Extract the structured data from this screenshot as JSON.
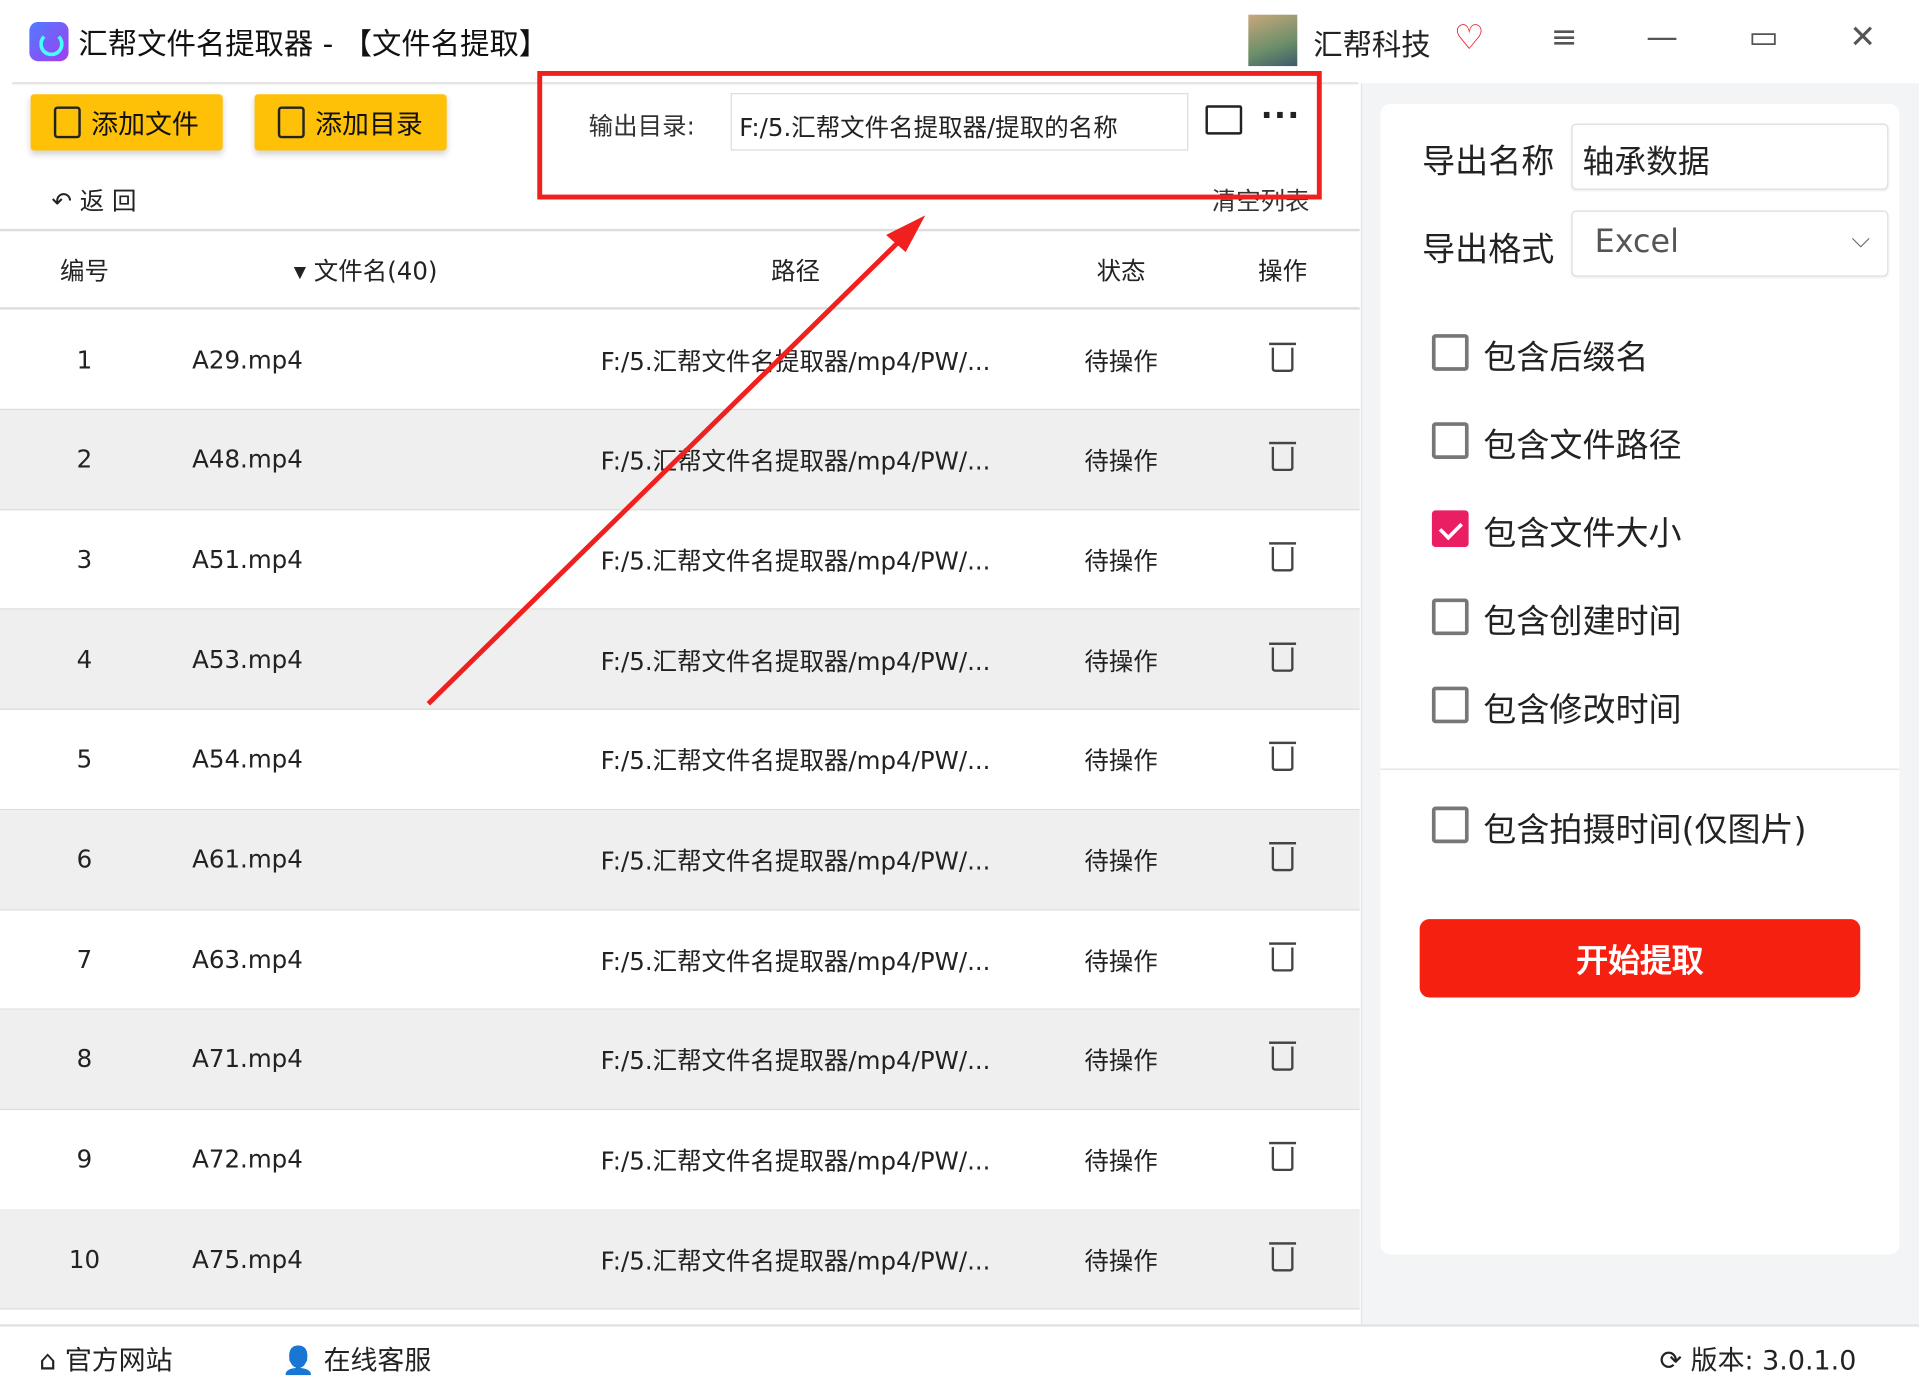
{
  "window": {
    "title": "汇帮文件名提取器 - 【文件名提取】",
    "brand": "汇帮科技"
  },
  "toolbar": {
    "add_file": "添加文件",
    "add_folder": "添加目录",
    "output_label": "输出目录:",
    "output_value": "F:/5.汇帮文件名提取器/提取的名称",
    "back": "返 回",
    "clear_list": "清空列表"
  },
  "table": {
    "headers": [
      "编号",
      "文件名(40)",
      "路径",
      "状态",
      "操作"
    ],
    "rows": [
      {
        "no": "1",
        "name": "A29.mp4",
        "path": "F:/5.汇帮文件名提取器/mp4/PW/...",
        "status": "待操作"
      },
      {
        "no": "2",
        "name": "A48.mp4",
        "path": "F:/5.汇帮文件名提取器/mp4/PW/...",
        "status": "待操作"
      },
      {
        "no": "3",
        "name": "A51.mp4",
        "path": "F:/5.汇帮文件名提取器/mp4/PW/...",
        "status": "待操作"
      },
      {
        "no": "4",
        "name": "A53.mp4",
        "path": "F:/5.汇帮文件名提取器/mp4/PW/...",
        "status": "待操作"
      },
      {
        "no": "5",
        "name": "A54.mp4",
        "path": "F:/5.汇帮文件名提取器/mp4/PW/...",
        "status": "待操作"
      },
      {
        "no": "6",
        "name": "A61.mp4",
        "path": "F:/5.汇帮文件名提取器/mp4/PW/...",
        "status": "待操作"
      },
      {
        "no": "7",
        "name": "A63.mp4",
        "path": "F:/5.汇帮文件名提取器/mp4/PW/...",
        "status": "待操作"
      },
      {
        "no": "8",
        "name": "A71.mp4",
        "path": "F:/5.汇帮文件名提取器/mp4/PW/...",
        "status": "待操作"
      },
      {
        "no": "9",
        "name": "A72.mp4",
        "path": "F:/5.汇帮文件名提取器/mp4/PW/...",
        "status": "待操作"
      },
      {
        "no": "10",
        "name": "A75.mp4",
        "path": "F:/5.汇帮文件名提取器/mp4/PW/...",
        "status": "待操作"
      }
    ]
  },
  "settings": {
    "export_name_label": "导出名称",
    "export_name_value": "轴承数据",
    "export_format_label": "导出格式",
    "export_format_value": "Excel",
    "options": [
      {
        "label": "包含后缀名",
        "checked": false
      },
      {
        "label": "包含文件路径",
        "checked": false
      },
      {
        "label": "包含文件大小",
        "checked": true
      },
      {
        "label": "包含创建时间",
        "checked": false
      },
      {
        "label": "包含修改时间",
        "checked": false
      },
      {
        "label": "包含拍摄时间(仅图片)",
        "checked": false
      }
    ],
    "start": "开始提取"
  },
  "footer": {
    "website": "官方网站",
    "support": "在线客服",
    "version": "版本: 3.0.1.0"
  },
  "colors": {
    "accent": "#f5200f",
    "button_yellow": "#ffc107",
    "checked": "#e91e63"
  }
}
